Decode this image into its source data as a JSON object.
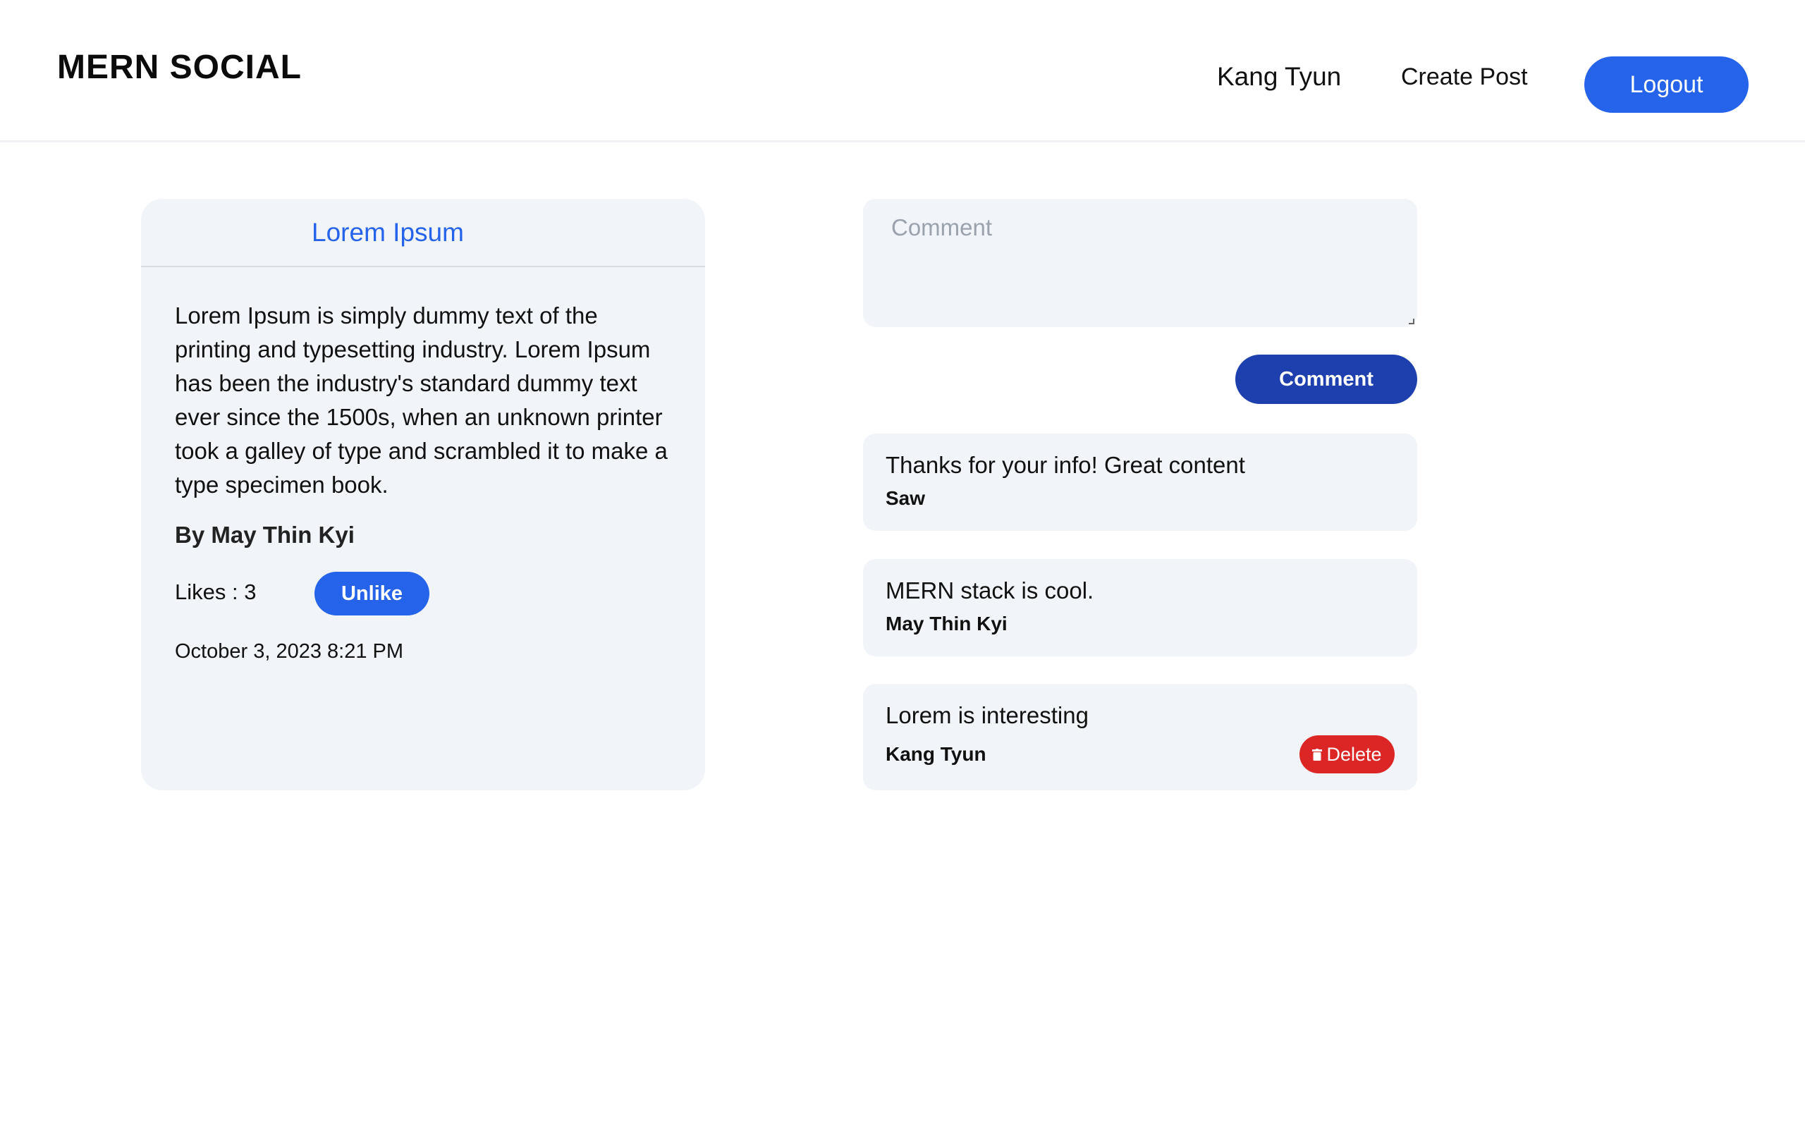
{
  "navbar": {
    "brand": "MERN SOCIAL",
    "user_name": "Kang Tyun",
    "create_post_label": "Create Post",
    "logout_label": "Logout"
  },
  "post": {
    "title": "Lorem Ipsum",
    "body": "Lorem Ipsum is simply dummy text of the printing and typesetting industry. Lorem Ipsum has been the industry's standard dummy text ever since the 1500s, when an unknown printer took a galley of type and scrambled it to make a type specimen book.",
    "author": "By May Thin Kyi",
    "likes_label": "Likes : 3",
    "unlike_label": "Unlike",
    "date": "October 3, 2023 8:21 PM"
  },
  "comment_form": {
    "placeholder": "Comment",
    "value": "",
    "submit_label": "Comment"
  },
  "comments": [
    {
      "text": "Thanks for your info! Great content",
      "author": "Saw"
    },
    {
      "text": "MERN stack is cool.",
      "author": "May Thin Kyi"
    },
    {
      "text": "Lorem is interesting",
      "author": "Kang Tyun",
      "delete_label": "Delete",
      "delete_icon": "trash-icon"
    }
  ],
  "colors": {
    "primary": "#2563eb",
    "primary_dark": "#1e40af",
    "danger": "#dc2626",
    "card_bg": "#f1f4f8"
  }
}
